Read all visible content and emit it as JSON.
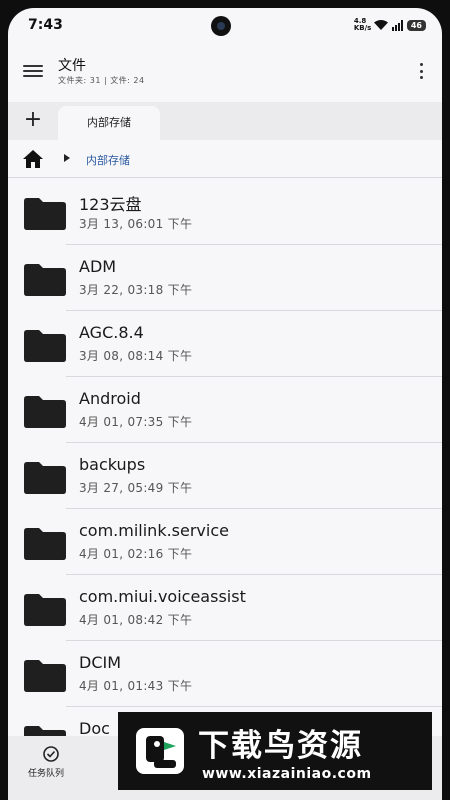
{
  "status_bar": {
    "time": "7:43",
    "signal_text": "4.8 KB/s",
    "battery": "46"
  },
  "app_bar": {
    "title": "文件",
    "subtitle": "文件夹: 31 | 文件: 24"
  },
  "tabs": {
    "add_label": "+",
    "active_tab": "内部存储"
  },
  "breadcrumb": {
    "current": "内部存储"
  },
  "files": [
    {
      "name": "123云盘",
      "date": "3月 13, 06:01 下午"
    },
    {
      "name": "ADM",
      "date": "3月 22, 03:18 下午"
    },
    {
      "name": "AGC.8.4",
      "date": "3月 08, 08:14 下午"
    },
    {
      "name": "Android",
      "date": "4月 01, 07:35 下午"
    },
    {
      "name": "backups",
      "date": "3月 27, 05:49 下午"
    },
    {
      "name": "com.milink.service",
      "date": "4月 01, 02:16 下午"
    },
    {
      "name": "com.miui.voiceassist",
      "date": "4月 01, 08:42 下午"
    },
    {
      "name": "DCIM",
      "date": "4月 01, 01:43 下午"
    },
    {
      "name": "Doc",
      "date": ""
    }
  ],
  "bottom_bar": {
    "queue_label": "任务队列"
  },
  "watermark": {
    "title": "下载鸟资源",
    "url": "www.xiazainiao.com"
  },
  "colors": {
    "breadcrumb_text": "#2c5aa0",
    "folder": "#1f1f1f",
    "screen_bg": "#f7f7f9"
  }
}
